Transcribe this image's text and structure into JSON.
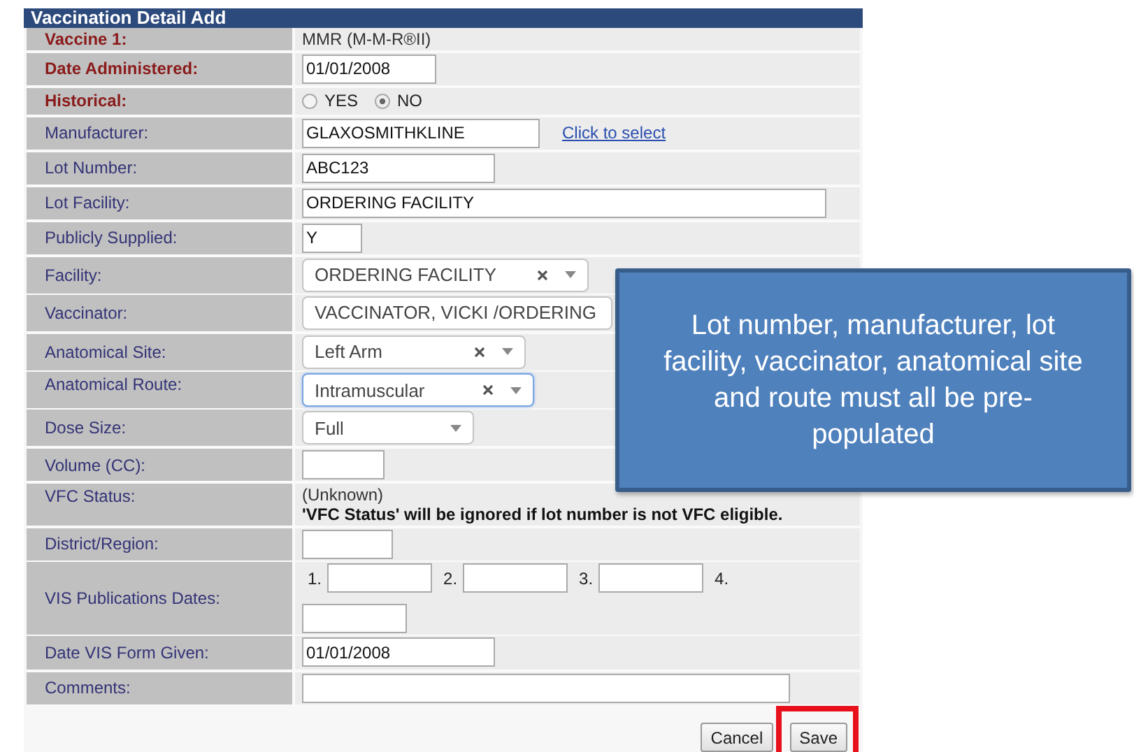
{
  "form": {
    "title": "Vaccination Detail Add",
    "rows": [
      {
        "kind": "text",
        "label": "Vaccine 1:",
        "required": true,
        "value": "MMR (M-M-R®II)"
      },
      {
        "kind": "input",
        "label": "Date Administered:",
        "required": true,
        "value": "01/01/2008"
      },
      {
        "kind": "radio",
        "label": "Historical:",
        "required": true,
        "options": [
          {
            "label": "YES",
            "selected": false
          },
          {
            "label": "NO",
            "selected": true
          }
        ]
      },
      {
        "kind": "input_link",
        "label": "Manufacturer:",
        "required": false,
        "value": "GLAXOSMITHKLINE",
        "link": "Click to select"
      },
      {
        "kind": "input",
        "label": "Lot Number:",
        "required": false,
        "value": "ABC123"
      },
      {
        "kind": "input",
        "label": "Lot Facility:",
        "required": false,
        "value": "ORDERING FACILITY"
      },
      {
        "kind": "input",
        "label": "Publicly Supplied:",
        "required": false,
        "value": "Y"
      },
      {
        "kind": "select",
        "label": "Facility:",
        "required": false,
        "value": "ORDERING FACILITY",
        "clearable": true,
        "focused": false
      },
      {
        "kind": "select",
        "label": "Vaccinator:",
        "required": false,
        "value": "VACCINATOR, VICKI /ORDERING",
        "focused": false
      },
      {
        "kind": "select",
        "label": "Anatomical Site:",
        "required": false,
        "value": "Left Arm",
        "clearable": true,
        "focused": false
      },
      {
        "kind": "select",
        "label": "Anatomical Route:",
        "required": false,
        "value": "Intramuscular",
        "clearable": true,
        "focused": true
      },
      {
        "kind": "select",
        "label": "Dose Size:",
        "required": false,
        "value": "Full",
        "clearable": false,
        "focused": false
      },
      {
        "kind": "input",
        "label": "Volume (CC):",
        "required": false
      },
      {
        "kind": "vfc",
        "label": "VFC Status:",
        "required": false,
        "value": "(Unknown)",
        "note": "'VFC Status' will be ignored if lot number is not VFC eligible."
      },
      {
        "kind": "input",
        "label": "District/Region:",
        "required": false
      },
      {
        "kind": "dates",
        "label": "VIS Publications Dates:",
        "required": false,
        "items": [
          "1.",
          "2.",
          "3.",
          "4."
        ]
      },
      {
        "kind": "input",
        "label": "Date VIS Form Given:",
        "required": false,
        "value": "01/01/2008"
      },
      {
        "kind": "input",
        "label": "Comments:",
        "required": false
      }
    ],
    "buttons": [
      {
        "label": "Cancel",
        "highlighted": false
      },
      {
        "label": "Save",
        "highlighted": true
      }
    ]
  },
  "callout": {
    "text": "Lot number, manufacturer, lot facility, vaccinator, anatomical site and route must all be pre-populated"
  }
}
